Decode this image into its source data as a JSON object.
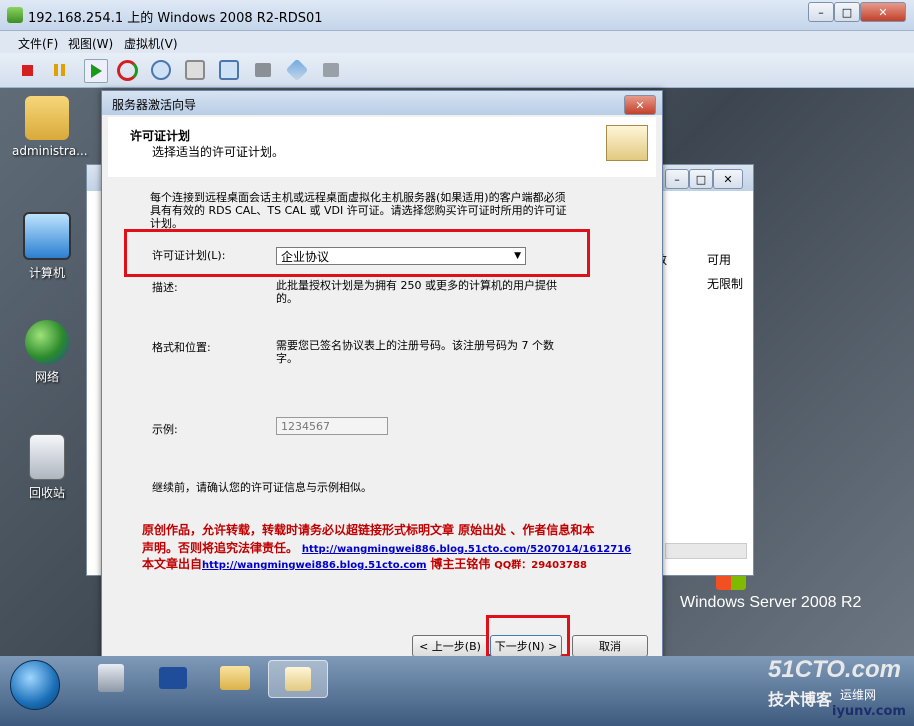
{
  "window": {
    "title": "192.168.254.1 上的 Windows 2008 R2-RDS01",
    "menu": [
      "文件(F)",
      "视图(W)",
      "虚拟机(V)"
    ],
    "toolbar_icons": [
      "stop-icon",
      "pause-icon",
      "play-icon",
      "reset-icon",
      "snapshot-icon",
      "revert-icon",
      "checkpoint-icon",
      "save-icon",
      "settings-icon",
      "properties-icon"
    ]
  },
  "desktop": {
    "icons": [
      {
        "label": "administra...",
        "icon": "user-folder-icon"
      },
      {
        "label": "计算机",
        "icon": "computer-icon"
      },
      {
        "label": "网络",
        "icon": "network-icon"
      },
      {
        "label": "回收站",
        "icon": "recycle-bin-icon"
      }
    ],
    "brand": "Windows Server 2008 R2"
  },
  "background_window": {
    "col_header": "可用",
    "cell": "无限制",
    "col_header_partial": "数"
  },
  "wizard": {
    "title": "服务器激活向导",
    "heading": "许可证计划",
    "subheading": "选择适当的许可证计划。",
    "intro": "每个连接到远程桌面会话主机或远程桌面虚拟化主机服务器(如果适用)的客户端都必须具有有效的 RDS CAL、TS CAL 或 VDI 许可证。请选择您购买许可证时所用的许可证计划。",
    "plan_label": "许可证计划(L):",
    "plan_value": "企业协议",
    "desc_label": "描述:",
    "desc_text": "此批量授权计划是为拥有 250 或更多的计算机的用户提供的。",
    "format_label": "格式和位置:",
    "format_text": "需要您已签名协议表上的注册号码。该注册号码为 7 个数字。",
    "example_label": "示例:",
    "example_value": "1234567",
    "confirm_text": "继续前，请确认您的许可证信息与示例相似。",
    "watermark_line1": "原创作品，允许转载，转载时请务必以超链接形式标明文章 原始出处 、作者信息和本",
    "watermark_line2a": "声明。否则将追究法律责任。",
    "watermark_link1": "http://wangmingwei886.blog.51cto.com/5207014/1612716",
    "watermark_line3a": "本文章出自",
    "watermark_link2": "http://wangmingwei886.blog.51cto.com",
    "watermark_line3b": "博主王铭伟",
    "watermark_qq": "QQ群：29403788",
    "back_button": "< 上一步(B)",
    "next_button": "下一步(N) >",
    "cancel_button": "取消"
  },
  "taskbar": {
    "items": [
      "server-manager-icon",
      "powershell-icon",
      "explorer-icon",
      "activation-wizard-icon"
    ]
  },
  "watermark_site": {
    "logo": "51CTO.com",
    "sub": "技术博客",
    "corner": "iyunv.com",
    "corner2": "运维网"
  },
  "colors": {
    "highlight": "#e0101a",
    "watermark_red": "#c00000",
    "link": "#0000cc"
  }
}
